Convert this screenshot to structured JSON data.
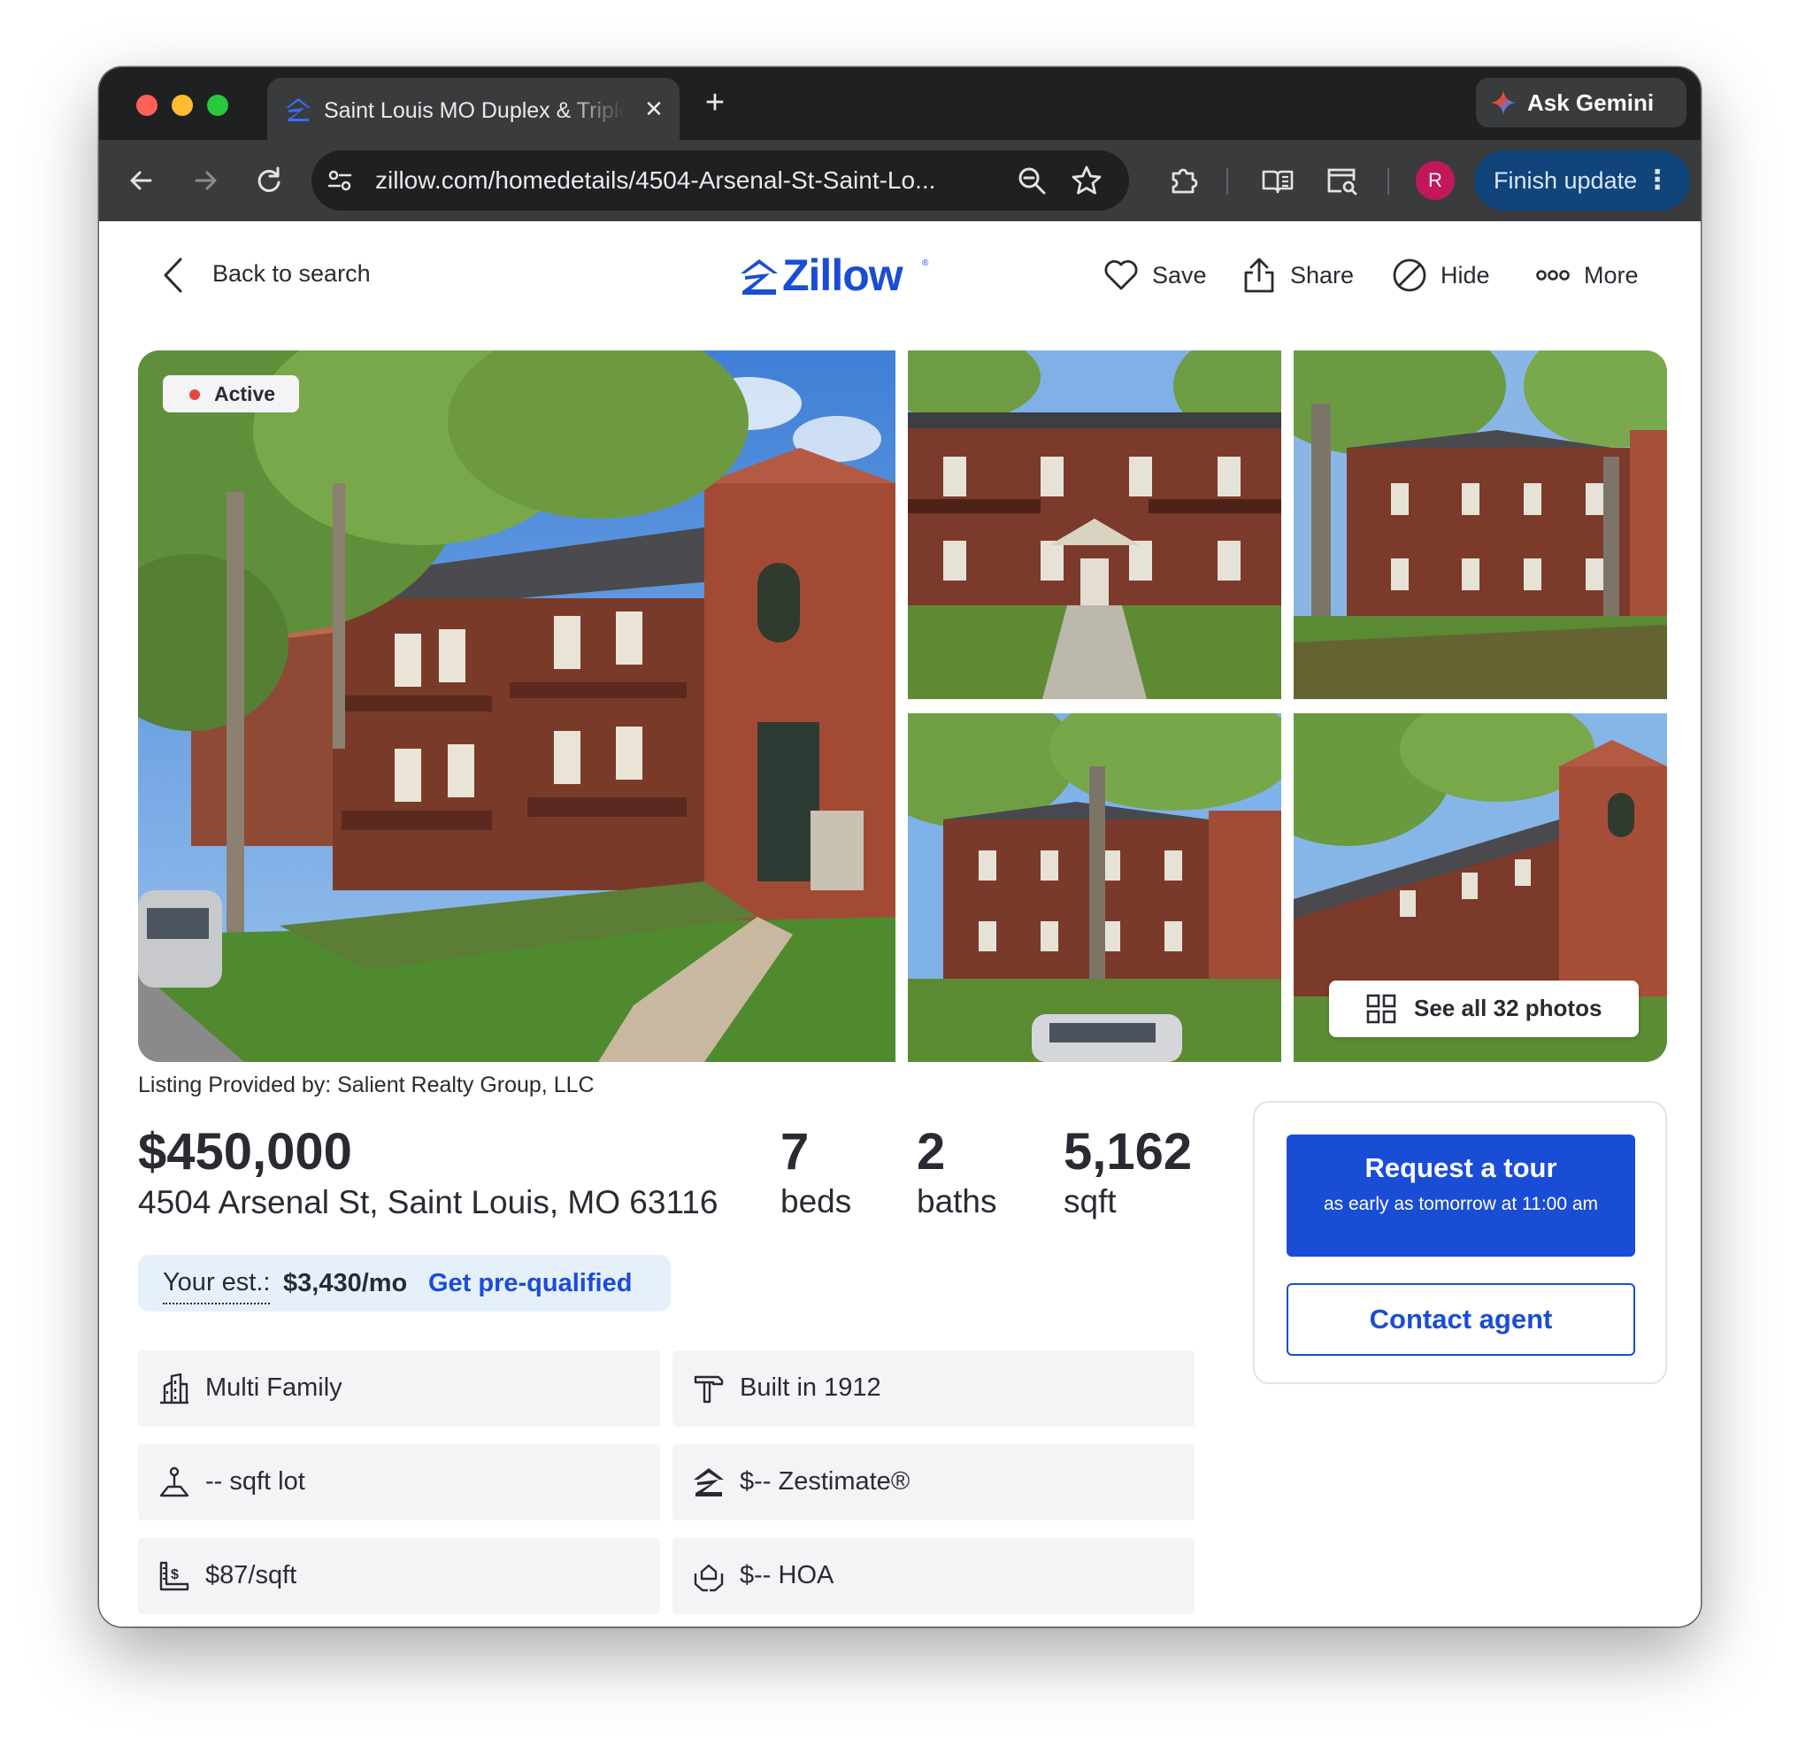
{
  "browser": {
    "tab_title": "Saint Louis MO Duplex & Triplex",
    "tab_close": "✕",
    "new_tab": "+",
    "ask_gemini": "Ask Gemini",
    "url": "zillow.com/homedetails/4504-Arsenal-St-Saint-Lo...",
    "profile_initial": "R",
    "finish_update": "Finish update",
    "menu_dots": "⋮"
  },
  "nav": {
    "back_label": "Back to search",
    "logo_text": "Zillow",
    "logo_reg": "®",
    "actions": {
      "save": "Save",
      "share": "Share",
      "hide": "Hide",
      "more": "More"
    }
  },
  "gallery": {
    "status_badge": "Active",
    "see_all": "See all 32 photos"
  },
  "listing": {
    "provided_by": "Listing Provided by: Salient Realty Group, LLC",
    "price": "$450,000",
    "address": "4504 Arsenal St, Saint Louis, MO 63116",
    "beds_value": "7",
    "beds_label": "beds",
    "baths_value": "2",
    "baths_label": "baths",
    "sqft_value": "5,162",
    "sqft_label": "sqft"
  },
  "estimate": {
    "label": "Your est.:",
    "value": "$3,430/mo",
    "link": "Get pre-qualified"
  },
  "facts": [
    {
      "label": "Multi Family",
      "icon": "building-icon"
    },
    {
      "label": "Built in 1912",
      "icon": "hammer-icon"
    },
    {
      "label": "-- sqft lot",
      "icon": "lot-icon"
    },
    {
      "label": "$-- Zestimate®",
      "icon": "zestimate-icon"
    },
    {
      "label": "$87/sqft",
      "icon": "price-per-sqft-icon"
    },
    {
      "label": "$-- HOA",
      "icon": "hoa-icon"
    }
  ],
  "cta": {
    "tour_title": "Request a tour",
    "tour_subtitle": "as early as tomorrow at 11:00 am",
    "contact": "Contact agent"
  },
  "colors": {
    "zillow_blue": "#1a4dd6",
    "estimate_bg": "#e5f0fb",
    "fact_bg": "#f4f4f6",
    "active_dot": "#e8473f",
    "chrome_dark": "#1f2021",
    "chrome_toolbar": "#3a3b3d",
    "update_pill": "#10447a"
  }
}
